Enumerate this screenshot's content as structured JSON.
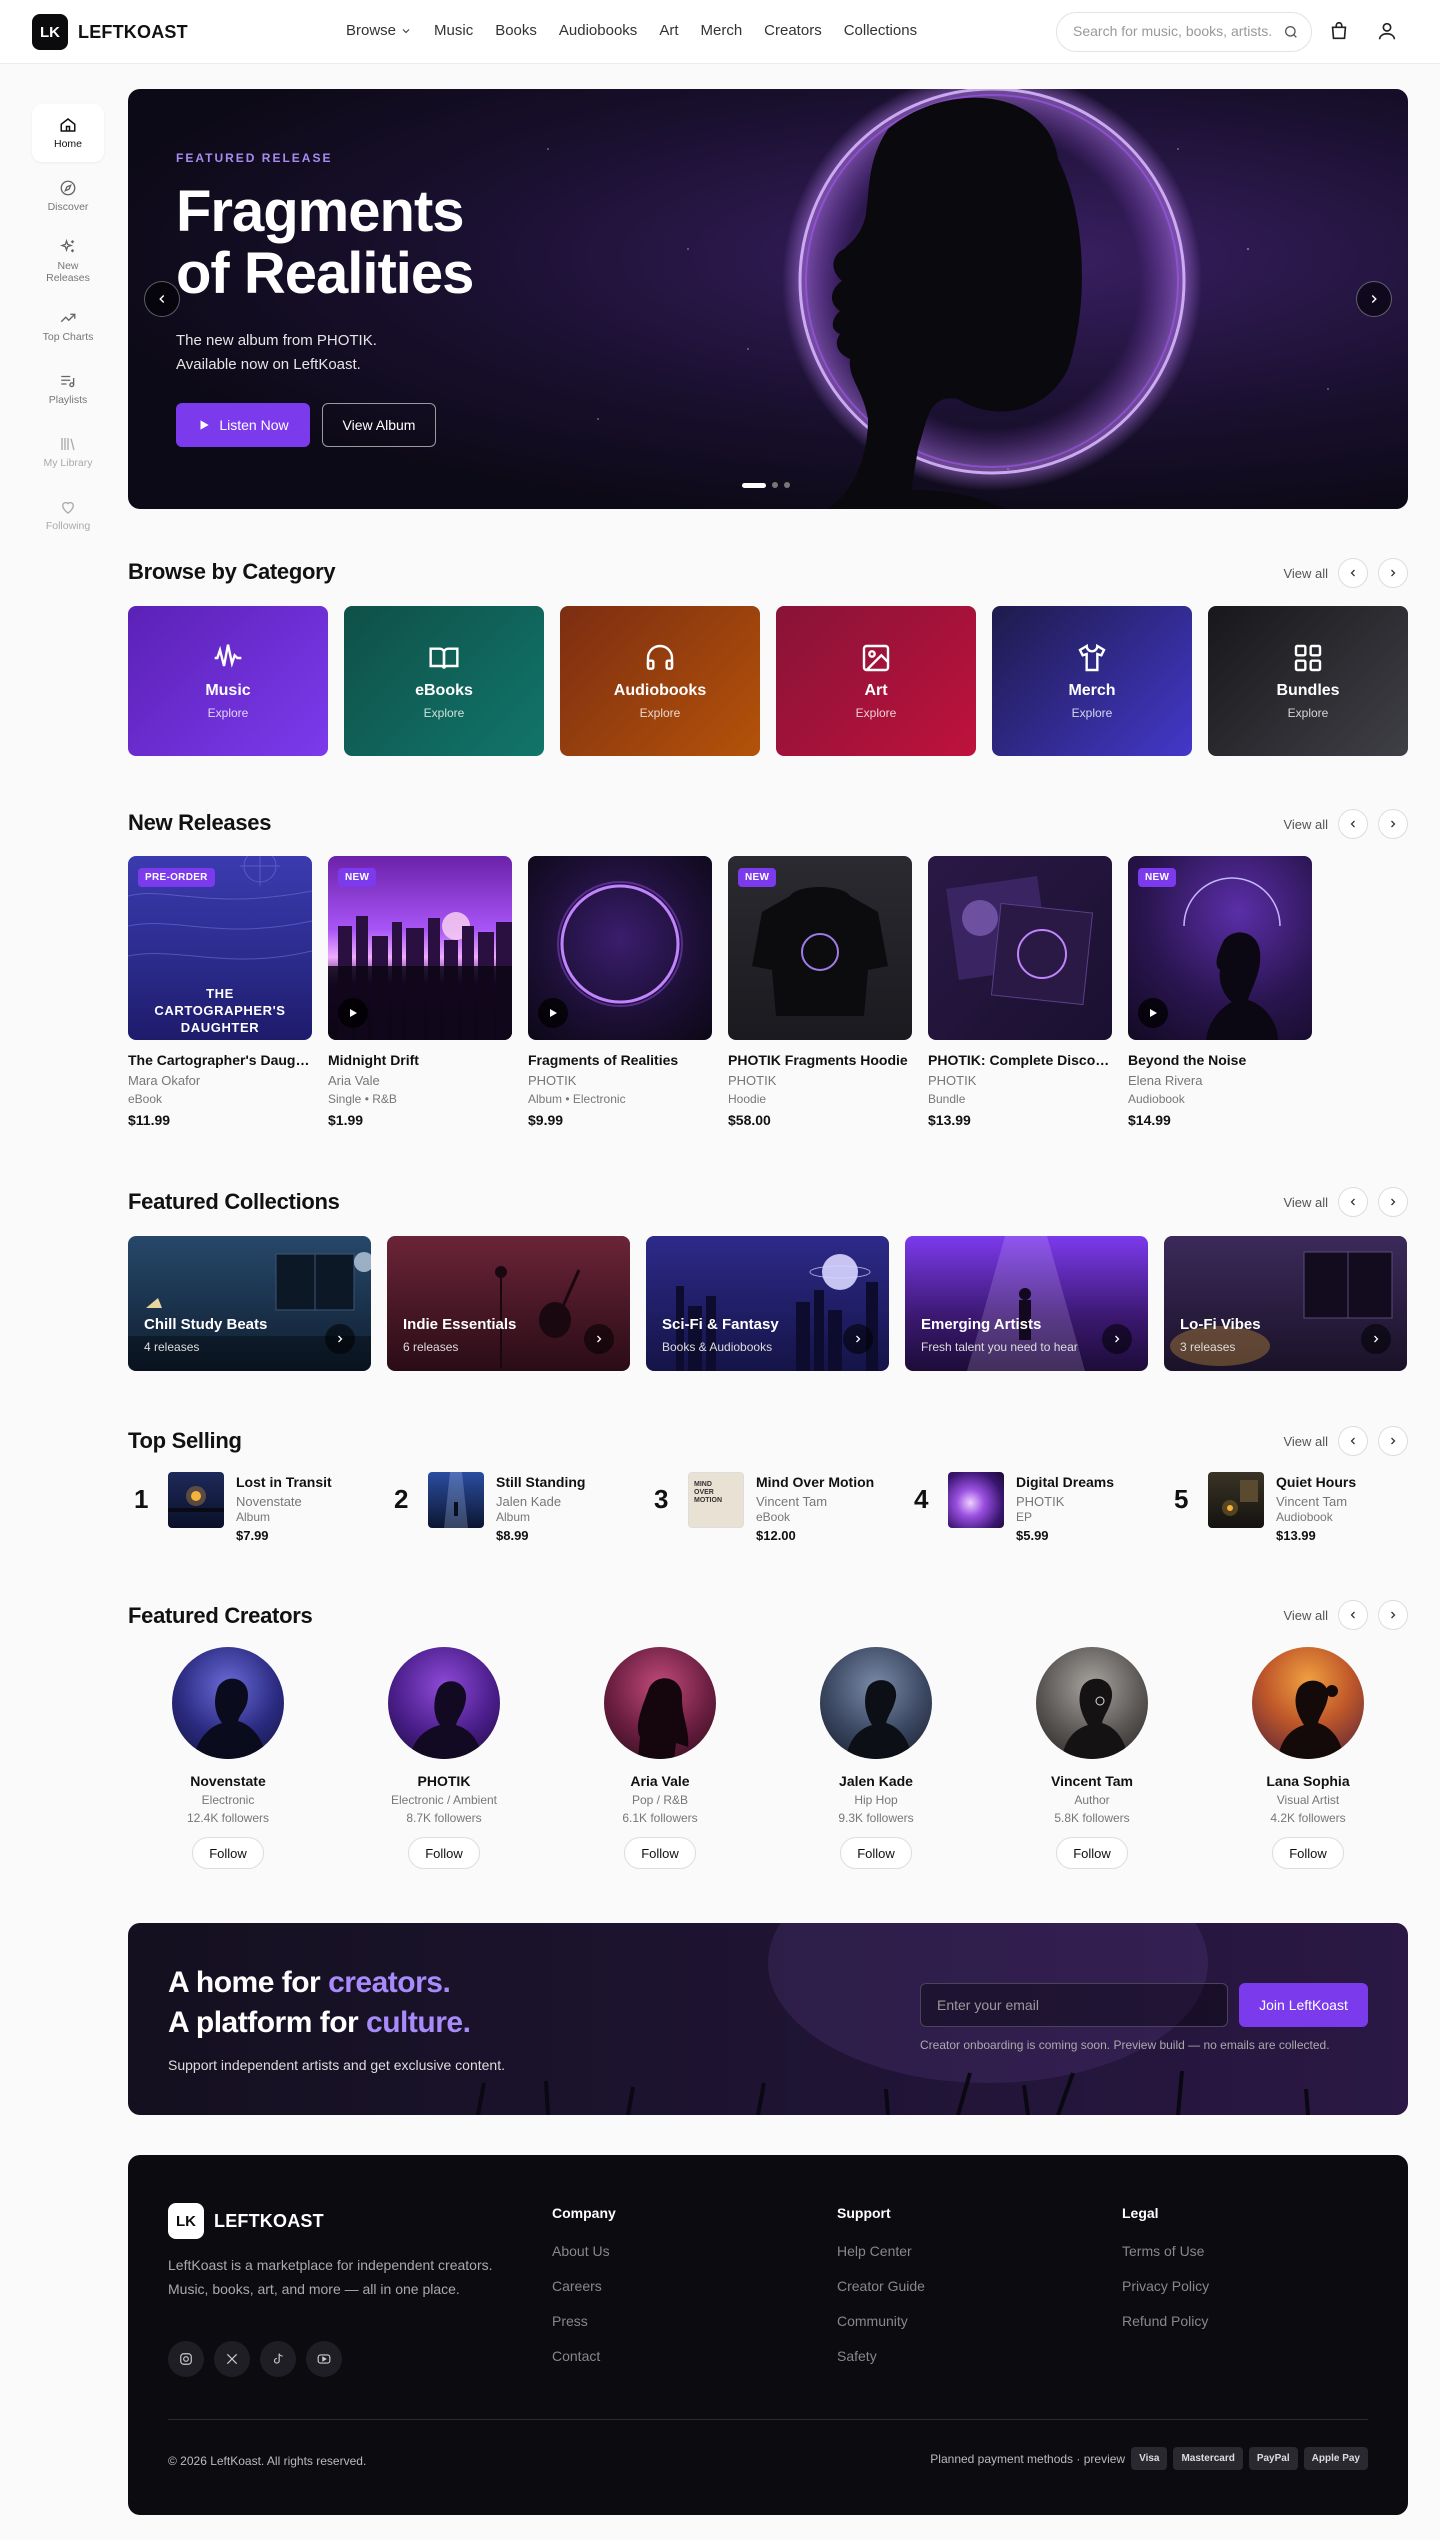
{
  "header": {
    "logo_mark": "LK",
    "logo_text": "LEFTKOAST",
    "nav": [
      "Browse",
      "Music",
      "Books",
      "Audiobooks",
      "Art",
      "Merch",
      "Creators",
      "Collections"
    ],
    "search_placeholder": "Search for music, books, artists..."
  },
  "sidebar": {
    "items": [
      {
        "label": "Home",
        "icon": "home-icon"
      },
      {
        "label": "Discover",
        "icon": "compass-icon"
      },
      {
        "label": "New Releases",
        "icon": "sparkles-icon"
      },
      {
        "label": "Top Charts",
        "icon": "trending-icon"
      },
      {
        "label": "Playlists",
        "icon": "playlist-icon"
      },
      {
        "label": "My Library",
        "icon": "library-icon"
      },
      {
        "label": "Following",
        "icon": "heart-icon"
      }
    ]
  },
  "hero": {
    "eyebrow": "FEATURED RELEASE",
    "title_line1": "Fragments",
    "title_line2": "of Realities",
    "sub_line1": "The new album from PHOTIK.",
    "sub_line2": "Available now on LeftKoast.",
    "primary": "Listen Now",
    "secondary": "View Album"
  },
  "sections": {
    "categories": "Browse by Category",
    "new_releases": "New Releases",
    "collections": "Featured Collections",
    "top_selling": "Top Selling",
    "creators": "Featured Creators",
    "view_all": "View all"
  },
  "categories": [
    {
      "name": "Music",
      "sub": "Explore",
      "colors": [
        "#5b21b6",
        "#7c3aed"
      ]
    },
    {
      "name": "eBooks",
      "sub": "Explore",
      "colors": [
        "#0f5048",
        "#11756a"
      ]
    },
    {
      "name": "Audiobooks",
      "sub": "Explore",
      "colors": [
        "#7c2d12",
        "#b45309"
      ]
    },
    {
      "name": "Art",
      "sub": "Explore",
      "colors": [
        "#881337",
        "#be123c"
      ]
    },
    {
      "name": "Merch",
      "sub": "Explore",
      "colors": [
        "#1e1b4b",
        "#4338ca"
      ]
    },
    {
      "name": "Bundles",
      "sub": "Explore",
      "colors": [
        "#18181b",
        "#3f3f46"
      ]
    }
  ],
  "new_releases": [
    {
      "badge": "PRE-ORDER",
      "cover_text": "THE CARTOGRAPHER'S DAUGHTER",
      "title": "The Cartographer's Daughter",
      "artist": "Mara Okafor",
      "meta": "eBook",
      "price": "$11.99"
    },
    {
      "badge": "NEW",
      "title": "Midnight Drift",
      "artist": "Aria Vale",
      "meta": "Single • R&B",
      "price": "$1.99"
    },
    {
      "badge": "",
      "title": "Fragments of Realities",
      "artist": "PHOTIK",
      "meta": "Album • Electronic",
      "price": "$9.99"
    },
    {
      "badge": "NEW",
      "title": "PHOTIK Fragments Hoodie",
      "artist": "PHOTIK",
      "meta": "Hoodie",
      "price": "$58.00"
    },
    {
      "badge": "",
      "title": "PHOTIK: Complete Discography",
      "artist": "PHOTIK",
      "meta": "Bundle",
      "price": "$13.99"
    },
    {
      "badge": "NEW",
      "title": "Beyond the Noise",
      "artist": "Elena Rivera",
      "meta": "Audiobook",
      "price": "$14.99"
    }
  ],
  "collections": [
    {
      "title": "Chill Study Beats",
      "sub": "4 releases"
    },
    {
      "title": "Indie Essentials",
      "sub": "6 releases"
    },
    {
      "title": "Sci-Fi & Fantasy",
      "sub": "Books & Audiobooks"
    },
    {
      "title": "Emerging Artists",
      "sub": "Fresh talent you need to hear"
    },
    {
      "title": "Lo-Fi Vibes",
      "sub": "3 releases"
    }
  ],
  "top_selling": [
    {
      "rank": "1",
      "title": "Lost in Transit",
      "artist": "Novenstate",
      "meta": "Album",
      "price": "$7.99"
    },
    {
      "rank": "2",
      "title": "Still Standing",
      "artist": "Jalen Kade",
      "meta": "Album",
      "price": "$8.99"
    },
    {
      "rank": "3",
      "title": "Mind Over Motion",
      "artist": "Vincent Tam",
      "meta": "eBook",
      "price": "$12.00",
      "cover_text": "MIND OVER MOTION"
    },
    {
      "rank": "4",
      "title": "Digital Dreams",
      "artist": "PHOTIK",
      "meta": "EP",
      "price": "$5.99"
    },
    {
      "rank": "5",
      "title": "Quiet Hours",
      "artist": "Vincent Tam",
      "meta": "Audiobook",
      "price": "$13.99"
    }
  ],
  "creators": [
    {
      "name": "Novenstate",
      "genre": "Electronic",
      "followers": "12.4K followers"
    },
    {
      "name": "PHOTIK",
      "genre": "Electronic / Ambient",
      "followers": "8.7K followers"
    },
    {
      "name": "Aria Vale",
      "genre": "Pop / R&B",
      "followers": "6.1K followers"
    },
    {
      "name": "Jalen Kade",
      "genre": "Hip Hop",
      "followers": "9.3K followers"
    },
    {
      "name": "Vincent Tam",
      "genre": "Author",
      "followers": "5.8K followers"
    },
    {
      "name": "Lana Sophia",
      "genre": "Visual Artist",
      "followers": "4.2K followers"
    }
  ],
  "follow_label": "Follow",
  "cta": {
    "line1_a": "A home for ",
    "line1_b": "creators.",
    "line2_a": "A platform for ",
    "line2_b": "culture.",
    "sub": "Support independent artists and get exclusive content.",
    "email_placeholder": "Enter your email",
    "button": "Join LeftKoast",
    "note": "Creator onboarding is coming soon. Preview build — no emails are collected."
  },
  "footer": {
    "logo_mark": "LK",
    "logo_text": "LEFTKOAST",
    "desc": "LeftKoast is a marketplace for independent creators. Music, books, art, and more — all in one place.",
    "columns": [
      {
        "heading": "Company",
        "links": [
          "About Us",
          "Careers",
          "Press",
          "Contact"
        ]
      },
      {
        "heading": "Support",
        "links": [
          "Help Center",
          "Creator Guide",
          "Community",
          "Safety"
        ]
      },
      {
        "heading": "Legal",
        "links": [
          "Terms of Use",
          "Privacy Policy",
          "Refund Policy"
        ]
      }
    ],
    "copyright": "© 2026 LeftKoast. All rights reserved.",
    "payments_label": "Planned payment methods · preview",
    "payments": [
      "Visa",
      "Mastercard",
      "PayPal",
      "Apple Pay"
    ]
  },
  "colors": {
    "accent": "#7c3aed",
    "accent_light": "#a78bfa"
  }
}
